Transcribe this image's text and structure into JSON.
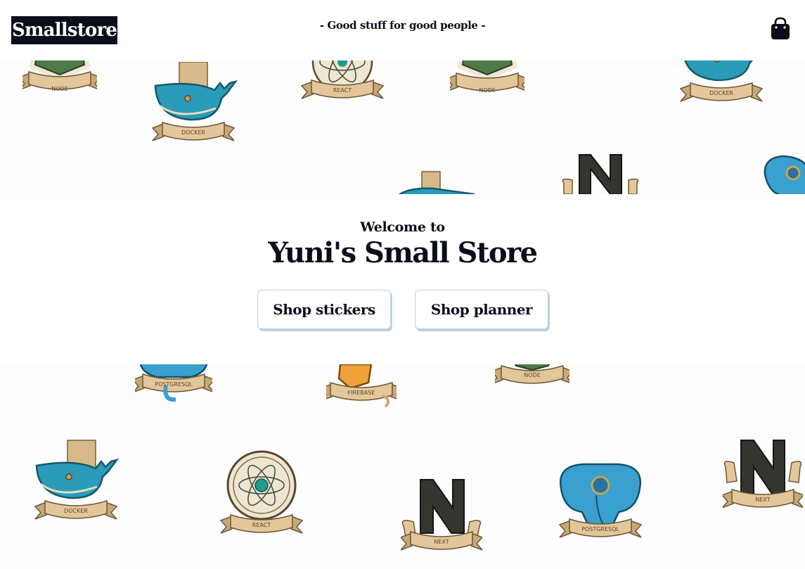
{
  "header": {
    "logo": "Smallstore",
    "tagline": "- Good stuff for good people -",
    "cart_icon": "shopping-bag-icon"
  },
  "hero": {
    "welcome": "Welcome to",
    "title": "Yuni's Small Store",
    "buttons": [
      {
        "label": "Shop stickers"
      },
      {
        "label": "Shop planner"
      }
    ]
  },
  "stickers": {
    "node": "NODE",
    "docker": "DOCKER",
    "react": "REACT",
    "next": "NEXT",
    "postgresql": "POSTGRESQL",
    "firebase": "FIREBASE"
  },
  "colors": {
    "ink": "#0b0d1a",
    "button_shadow": "#bcd0e4",
    "banner": "#e3c79a",
    "whale": "#2a9bb8",
    "elephant": "#3aa0d0",
    "node_green": "#4e7a48",
    "next_dark": "#33352f",
    "firebase_orange": "#f0a23a"
  }
}
